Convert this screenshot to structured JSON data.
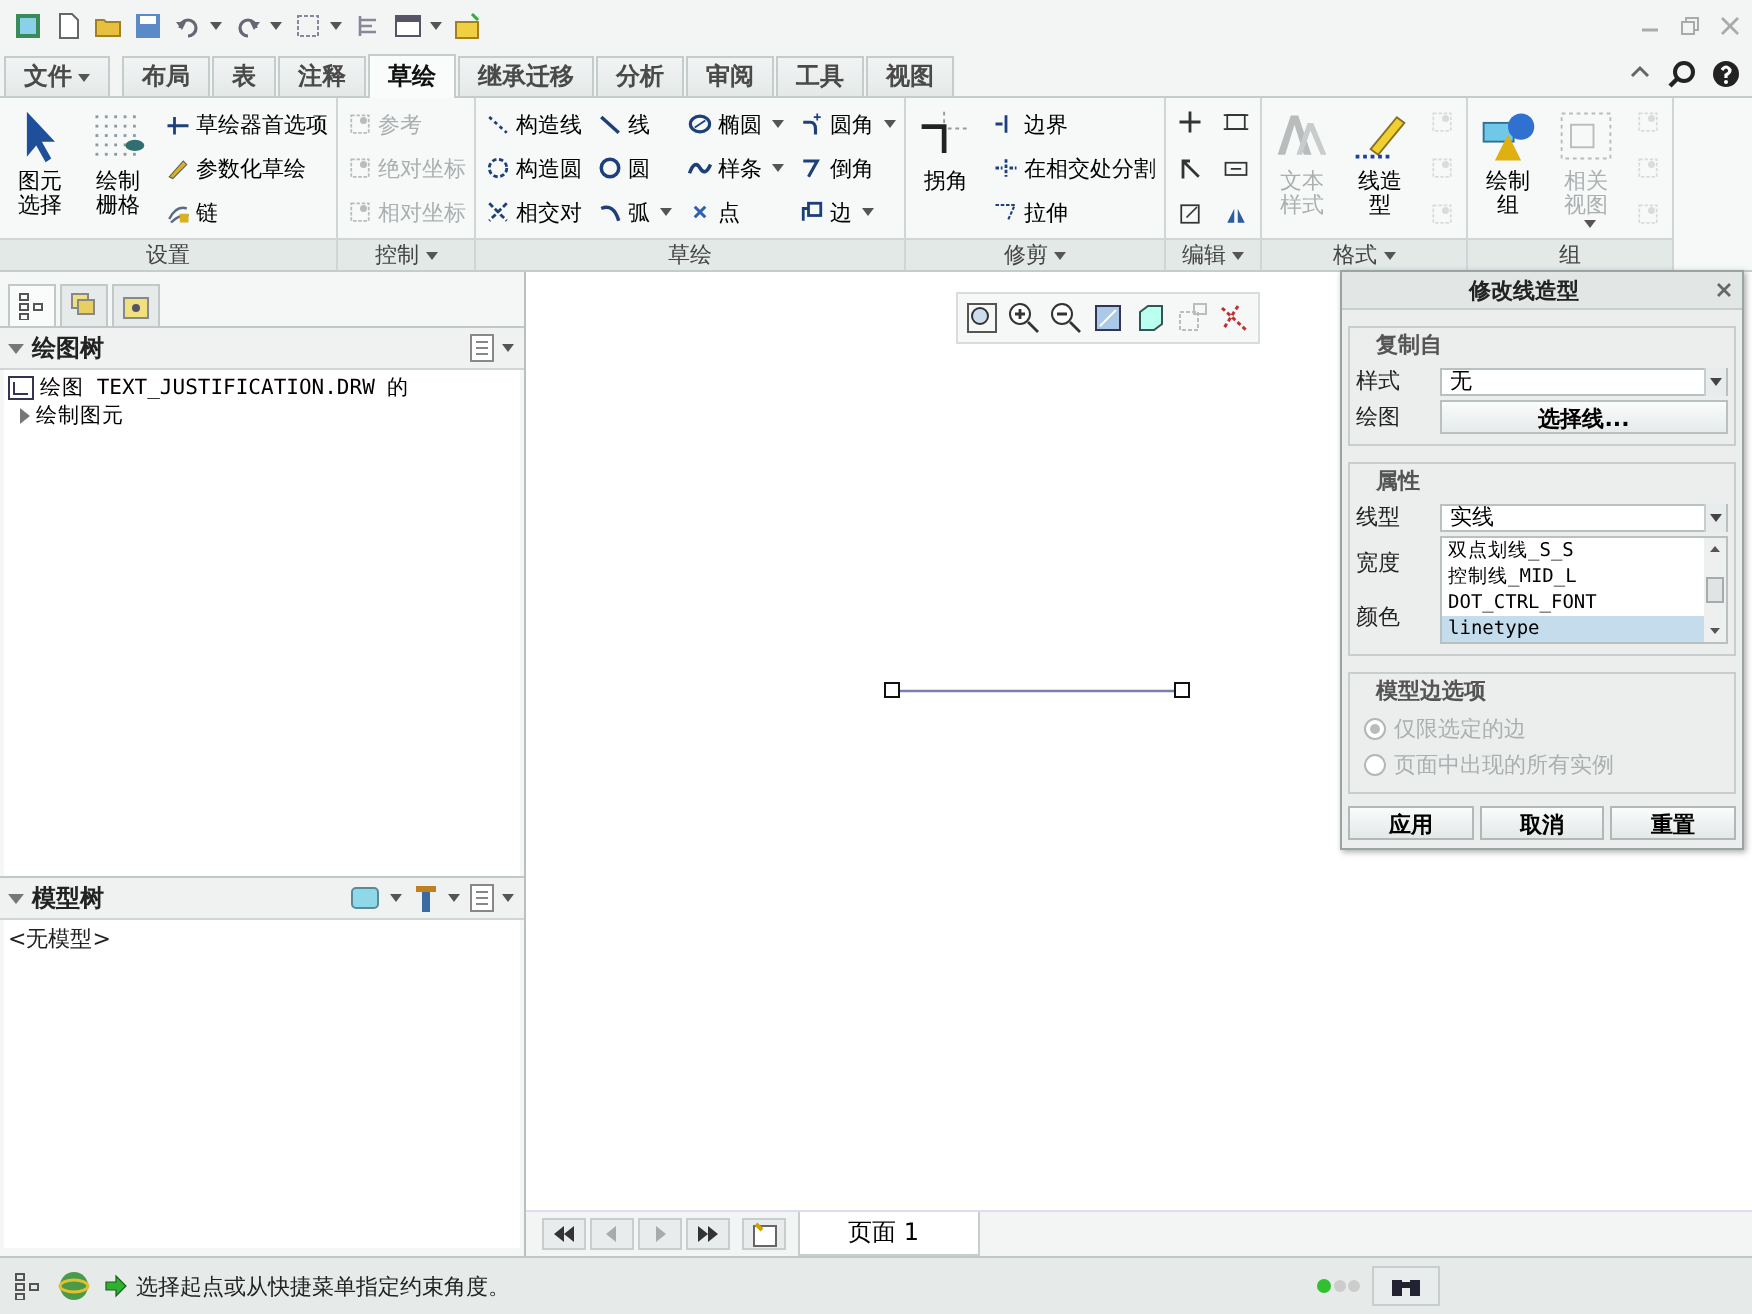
{
  "quick_access": {
    "buttons": [
      {
        "menu": false
      },
      {
        "menu": false
      },
      {
        "menu": false
      },
      {
        "menu": false
      },
      {
        "menu": true
      },
      {
        "menu": true
      },
      {
        "menu": true
      },
      {
        "menu": false
      },
      {
        "menu": true
      },
      {
        "menu": false
      }
    ]
  },
  "tabs": [
    {
      "label": "文件",
      "selected": false,
      "menu": true
    },
    {
      "label": "布局",
      "selected": false,
      "menu": false
    },
    {
      "label": "表",
      "selected": false,
      "menu": false
    },
    {
      "label": "注释",
      "selected": false,
      "menu": false
    },
    {
      "label": "草绘",
      "selected": true,
      "menu": false
    },
    {
      "label": "继承迁移",
      "selected": false,
      "menu": false
    },
    {
      "label": "分析",
      "selected": false,
      "menu": false
    },
    {
      "label": "审阅",
      "selected": false,
      "menu": false
    },
    {
      "label": "工具",
      "selected": false,
      "menu": false
    },
    {
      "label": "视图",
      "selected": false,
      "menu": false
    }
  ],
  "ribbon": {
    "groups": [
      {
        "label": "设置",
        "menu": false,
        "items": [
          {
            "kind": "big",
            "label": "图元选择",
            "disabled": false,
            "menu": false
          },
          {
            "kind": "big",
            "label": "绘制栅格",
            "disabled": false,
            "menu": false
          },
          {
            "kind": "small",
            "label": "草绘器首选项",
            "disabled": false,
            "menu": false
          },
          {
            "kind": "small",
            "label": "参数化草绘",
            "disabled": false,
            "menu": false
          },
          {
            "kind": "small",
            "label": "链",
            "disabled": false,
            "menu": false
          }
        ]
      },
      {
        "label": "控制",
        "menu": true,
        "items": [
          {
            "kind": "small",
            "label": "参考",
            "disabled": true,
            "menu": false
          },
          {
            "kind": "small",
            "label": "绝对坐标",
            "disabled": true,
            "menu": false
          },
          {
            "kind": "small",
            "label": "相对坐标",
            "disabled": true,
            "menu": false
          }
        ]
      },
      {
        "label": "草绘",
        "menu": false,
        "items": [
          {
            "kind": "small",
            "label": "构造线",
            "disabled": false,
            "menu": false
          },
          {
            "kind": "small",
            "label": "构造圆",
            "disabled": false,
            "menu": false
          },
          {
            "kind": "small",
            "label": "相交对",
            "disabled": false,
            "menu": false
          },
          {
            "kind": "small",
            "label": "线",
            "disabled": false,
            "menu": false
          },
          {
            "kind": "small",
            "label": "圆",
            "disabled": false,
            "menu": false
          },
          {
            "kind": "small",
            "label": "弧",
            "disabled": false,
            "menu": true
          },
          {
            "kind": "small",
            "label": "椭圆",
            "disabled": false,
            "menu": true
          },
          {
            "kind": "small",
            "label": "样条",
            "disabled": false,
            "menu": true
          },
          {
            "kind": "small",
            "label": "点",
            "disabled": false,
            "menu": false
          },
          {
            "kind": "small",
            "label": "圆角",
            "disabled": false,
            "menu": true
          },
          {
            "kind": "small",
            "label": "倒角",
            "disabled": false,
            "menu": false
          },
          {
            "kind": "small",
            "label": "边",
            "disabled": false,
            "menu": true
          }
        ]
      },
      {
        "label": "修剪",
        "menu": true,
        "items": [
          {
            "kind": "big",
            "label": "拐角",
            "disabled": false,
            "menu": false
          },
          {
            "kind": "small",
            "label": "边界",
            "disabled": false,
            "menu": false
          },
          {
            "kind": "small",
            "label": "在相交处分割",
            "disabled": false,
            "menu": false
          },
          {
            "kind": "small",
            "label": "拉伸",
            "disabled": false,
            "menu": false
          }
        ]
      },
      {
        "label": "编辑",
        "menu": true,
        "items": [
          {
            "kind": "icon",
            "disabled": false
          },
          {
            "kind": "icon",
            "disabled": false
          },
          {
            "kind": "icon",
            "disabled": false
          },
          {
            "kind": "icon",
            "disabled": false
          },
          {
            "kind": "icon",
            "disabled": false
          },
          {
            "kind": "icon",
            "disabled": false
          }
        ]
      },
      {
        "label": "格式",
        "menu": true,
        "items": [
          {
            "kind": "big",
            "label": "文本样式",
            "disabled": true,
            "menu": false
          },
          {
            "kind": "big",
            "label": "线造型",
            "disabled": false,
            "menu": false
          },
          {
            "kind": "icon",
            "disabled": true
          },
          {
            "kind": "icon",
            "disabled": true
          },
          {
            "kind": "icon",
            "disabled": true
          }
        ]
      },
      {
        "label": "组",
        "menu": false,
        "items": [
          {
            "kind": "big",
            "label": "绘制组",
            "disabled": false,
            "menu": false
          },
          {
            "kind": "big",
            "label": "相关视图",
            "disabled": true,
            "menu": true
          },
          {
            "kind": "icon",
            "disabled": true
          },
          {
            "kind": "icon",
            "disabled": true
          },
          {
            "kind": "icon",
            "disabled": true
          }
        ]
      }
    ]
  },
  "left_panel": {
    "tabs": [
      {
        "selected": true
      },
      {
        "selected": false
      },
      {
        "selected": false
      }
    ],
    "drawing_tree": {
      "title": "绘图树",
      "items": [
        {
          "label": "绘图 TEXT_JUSTIFICATION.DRW 的",
          "children": [
            {
              "label": "绘制图元",
              "expanded": false
            }
          ]
        }
      ]
    },
    "model_tree": {
      "title": "模型树",
      "empty_text": "<无模型>"
    }
  },
  "canvas_toolbar": {
    "buttons": [
      {
        "disabled": false
      },
      {
        "disabled": false
      },
      {
        "disabled": false
      },
      {
        "disabled": false
      },
      {
        "disabled": false
      },
      {
        "disabled": true
      },
      {
        "disabled": false
      }
    ]
  },
  "dialog": {
    "title": "修改线造型",
    "copy_from": {
      "title": "复制自",
      "style_label": "样式",
      "style_value": "无",
      "drawing_label": "绘图",
      "select_button": "选择线..."
    },
    "properties": {
      "title": "属性",
      "linetype_label": "线型",
      "linetype_value": "实线",
      "width_label": "宽度",
      "color_label": "颜色",
      "options": [
        {
          "label": "双点划线_S_S",
          "selected": false
        },
        {
          "label": "控制线_MID_L",
          "selected": false
        },
        {
          "label": "DOT_CTRL_FONT",
          "selected": false
        },
        {
          "label": "linetype",
          "selected": true
        }
      ]
    },
    "model_edge": {
      "title": "模型边选项",
      "disabled": true,
      "options": [
        {
          "label": "仅限选定的边",
          "selected": true
        },
        {
          "label": "页面中出现的所有实例",
          "selected": false
        }
      ]
    },
    "buttons": [
      "应用",
      "取消",
      "重置"
    ]
  },
  "page_bar": {
    "page_label": "页面 1"
  },
  "status_bar": {
    "message": "选择起点或从快捷菜单指定约束角度。"
  }
}
